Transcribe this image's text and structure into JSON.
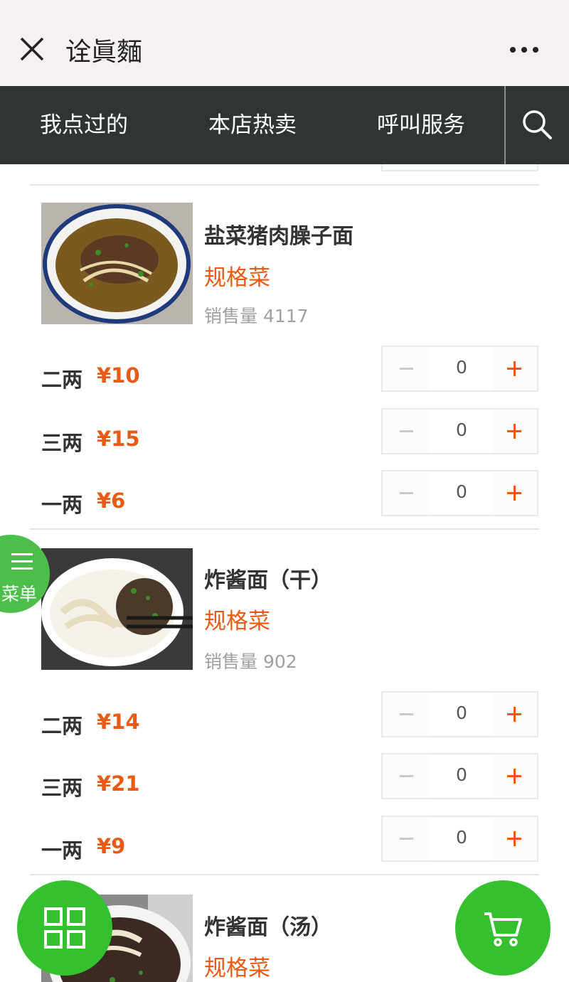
{
  "title_bar": {
    "title": "诠眞麵"
  },
  "nav": {
    "tabs": [
      "我点过的",
      "本店热卖",
      "呼叫服务"
    ]
  },
  "dishes": [
    {
      "name": "盐菜猪肉臊子面",
      "tag": "规格菜",
      "sales_label": "销售量",
      "sales": "4117",
      "specs": [
        {
          "name": "二两",
          "price": "¥10",
          "qty": "0"
        },
        {
          "name": "三两",
          "price": "¥15",
          "qty": "0"
        },
        {
          "name": "一两",
          "price": "¥6",
          "qty": "0"
        }
      ]
    },
    {
      "name": "炸酱面（干）",
      "tag": "规格菜",
      "sales_label": "销售量",
      "sales": "902",
      "specs": [
        {
          "name": "二两",
          "price": "¥14",
          "qty": "0"
        },
        {
          "name": "三两",
          "price": "¥21",
          "qty": "0"
        },
        {
          "name": "一两",
          "price": "¥9",
          "qty": "0"
        }
      ]
    },
    {
      "name": "炸酱面（汤）",
      "tag": "规格菜"
    }
  ],
  "side_menu": {
    "label": "菜单"
  },
  "icons": {
    "close": "close-icon",
    "more": "more-icon",
    "search": "search-icon",
    "menu": "menu-lines-icon",
    "grid": "grid-icon",
    "cart": "cart-icon"
  },
  "colors": {
    "navbar": "#2f3535",
    "accent_price": "#e95a15",
    "fab_green": "#35c12f",
    "side_menu_green": "#4cbf4a"
  }
}
